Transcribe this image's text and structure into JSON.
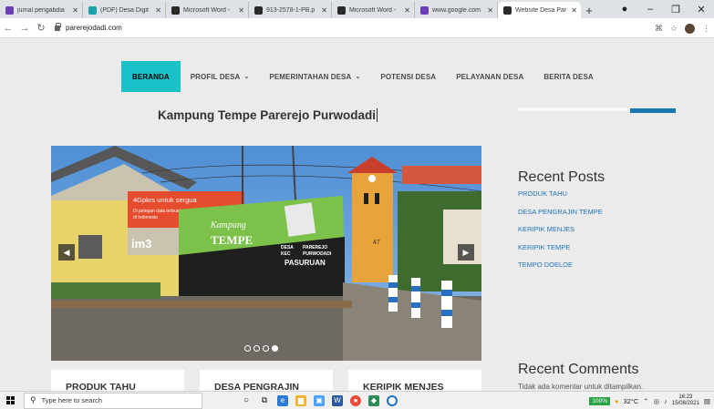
{
  "browser": {
    "tabs": [
      {
        "title": "jurnal pengabdia",
        "favicon_color": "#6b3fb8",
        "favicon": "icon-mark"
      },
      {
        "title": "(PDF) Desa Digit",
        "favicon_color": "#1aa3a8",
        "favicon": "icon-mark"
      },
      {
        "title": "Microsoft Word -",
        "favicon_color": "#2a2a2a",
        "favicon": "globe-icon"
      },
      {
        "title": "913-2578-1-PB.p",
        "favicon_color": "#2a2a2a",
        "favicon": "globe-icon"
      },
      {
        "title": "Microsoft Word -",
        "favicon_color": "#2a2a2a",
        "favicon": "globe-icon"
      },
      {
        "title": "www.google.com",
        "favicon_color": "#6b3fb8",
        "favicon": "icon-mark"
      },
      {
        "title": "Website Desa Par",
        "favicon_color": "#2a2a2a",
        "favicon": "globe-icon"
      }
    ],
    "close_glyph": "✕",
    "new_tab_glyph": "+",
    "window_controls": [
      "●",
      "–",
      "❐",
      "✕"
    ],
    "url": "parerejodadi.com"
  },
  "site": {
    "nav": [
      {
        "label": "BERANDA",
        "active": true,
        "caret": false
      },
      {
        "label": "PROFIL DESA",
        "active": false,
        "caret": true
      },
      {
        "label": "PEMERINTAHAN DESA",
        "active": false,
        "caret": true
      },
      {
        "label": "POTENSI DESA",
        "active": false,
        "caret": false
      },
      {
        "label": "PELAYANAN DESA",
        "active": false,
        "caret": false
      },
      {
        "label": "BERITA DESA",
        "active": false,
        "caret": false
      }
    ],
    "caret_glyph": "⌄",
    "title": "Kampung Tempe Parerejo Purwodadi",
    "slider": {
      "banner_text_1": "4Gpkrs untuk sergua",
      "banner_text_2": "Di jaringan data terbuat",
      "banner_text_3": "di Indonesia",
      "banner_brand": "im3",
      "sign_line_1": "Kampung",
      "sign_line_2": "TEMPE",
      "sign_desa": "DESA",
      "sign_desa_name": "PAREREJO",
      "sign_kec": "KEC",
      "sign_kec_name": "PURWODADI",
      "sign_region": "PASURUAN",
      "tower_number": "47",
      "dots": 4,
      "active_dot": 3,
      "prev_glyph": "◀",
      "next_glyph": "▶"
    },
    "cards": [
      "PRODUK TAHU",
      "DESA PENGRAJIN",
      "KERIPIK MENJES"
    ],
    "recent_posts_title": "Recent Posts",
    "recent_posts": [
      "PRODUK TAHU",
      "DESA PENGRAJIN TEMPE",
      "KERIPIK MENJES",
      "KERIPIK TEMPE",
      "TEMPO DOELOE"
    ],
    "recent_comments_title": "Recent Comments",
    "no_comments": "Tidak ada komentar untuk ditampilkan."
  },
  "taskbar": {
    "search_placeholder": "Type here to search",
    "battery": "100%",
    "temperature": "32°C",
    "time": "16:23",
    "date": "15/08/2021"
  },
  "colors": {
    "accent_nav": "#19c1c8",
    "link": "#1e73be",
    "search_button": "#1877ad"
  }
}
